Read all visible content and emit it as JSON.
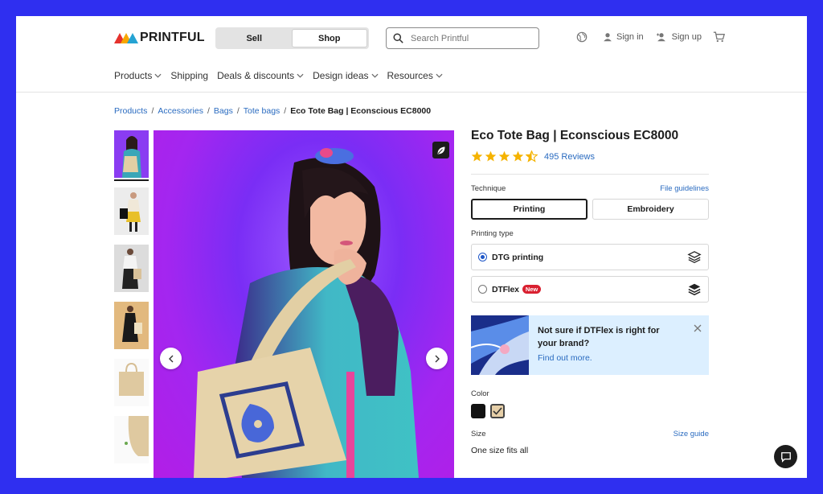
{
  "header": {
    "logo_text": "PRINTFUL",
    "mode_tabs": [
      {
        "label": "Sell",
        "active": false
      },
      {
        "label": "Shop",
        "active": true
      }
    ],
    "search_placeholder": "Search Printful",
    "sign_in": "Sign in",
    "sign_up": "Sign up"
  },
  "nav": {
    "items": [
      {
        "label": "Products",
        "has_menu": true
      },
      {
        "label": "Shipping",
        "has_menu": false
      },
      {
        "label": "Deals & discounts",
        "has_menu": true
      },
      {
        "label": "Design ideas",
        "has_menu": true
      },
      {
        "label": "Resources",
        "has_menu": true
      }
    ]
  },
  "breadcrumb": {
    "links": [
      "Products",
      "Accessories",
      "Bags",
      "Tote bags"
    ],
    "current": "Eco Tote Bag | Econscious EC8000",
    "separator": "/"
  },
  "product": {
    "title": "Eco Tote Bag | Econscious EC8000",
    "rating_value": 4.5,
    "reviews_label": "495 Reviews",
    "technique": {
      "label": "Technique",
      "link": "File guidelines",
      "options": [
        "Printing",
        "Embroidery"
      ],
      "selected": "Printing"
    },
    "printing_type": {
      "label": "Printing type",
      "options": [
        {
          "label": "DTG printing",
          "selected": true,
          "badge": ""
        },
        {
          "label": "DTFlex",
          "selected": false,
          "badge": "New"
        }
      ]
    },
    "promo": {
      "question": "Not sure if DTFlex is right for your brand?",
      "link": "Find out more."
    },
    "color": {
      "label": "Color",
      "swatches": [
        {
          "name": "black",
          "hex": "#111111",
          "selected": false
        },
        {
          "name": "natural",
          "hex": "#e6cfa8",
          "selected": true
        }
      ]
    },
    "size": {
      "label": "Size",
      "link": "Size guide",
      "value": "One size fits all"
    }
  },
  "gallery": {
    "thumbnail_count": 6,
    "selected_index": 0
  },
  "colors": {
    "accent_blue": "#2a6bc0",
    "star": "#f5b301",
    "promo_bg": "#dcefff",
    "new_badge": "#d92030",
    "frame": "#2f2ff0"
  }
}
